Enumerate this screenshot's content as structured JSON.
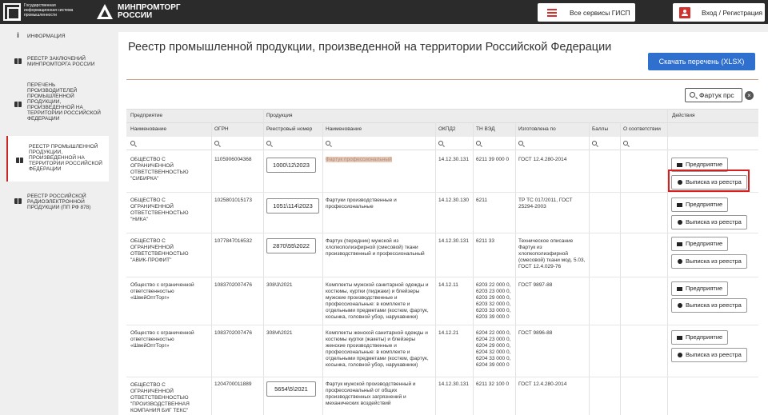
{
  "header": {
    "gisp_text": [
      "Государственная",
      "информационная система",
      "промышленности"
    ],
    "ministry": [
      "МИНПРОМТОРГ",
      "РОССИИ"
    ],
    "services_label": "Все сервисы ГИСП",
    "login_label": "Вход / Регистрация"
  },
  "sidebar": {
    "items": [
      {
        "label": "Информация",
        "icon": "info-icon"
      },
      {
        "label": "Реестр заключений Минпромторга России",
        "icon": "book-icon"
      },
      {
        "label": "Перечень производителей промышленной продукции, произведенной на территории Российской Федерации",
        "icon": "book-icon"
      },
      {
        "label": "Реестр промышленной продукции, произведенной на территории Российской Федерации",
        "icon": "book-icon",
        "active": true
      },
      {
        "label": "Реестр российской радиоэлектронной продукции (ПП РФ 878)",
        "icon": "book-icon"
      }
    ]
  },
  "main": {
    "title": "Реестр промышленной продукции, произведенной на территории Российской Федерации",
    "download_label": "Скачать перечень (XLSX)",
    "search_value": "Фартук прс",
    "clear_label": "×"
  },
  "table": {
    "group_headers": {
      "enterprise": "Предприятие",
      "product": "Продукция",
      "actions": "Действия"
    },
    "columns": [
      "Наименование",
      "ОГРН",
      "Реестровый номер",
      "Наименование",
      "ОКПД2",
      "ТН ВЭД",
      "Изготовлена по",
      "Баллы",
      "О соответствии"
    ],
    "actions": {
      "enterprise_label": "Предприятие",
      "extract_label": "Выписка из реестра"
    },
    "rows": [
      {
        "name": "ОБЩЕСТВО С ОГРАНИЧЕННОЙ ОТВЕТСТВЕННОСТЬЮ \"СИБИРКА\"",
        "ogrn": "1105906004368",
        "reg": "1000\\12\\2023",
        "product": "Фартук профессиональный",
        "okpd": "14.12.30.131",
        "tnved": "6211 39 000 0",
        "made_by": "ГОСТ 12.4.280-2014"
      },
      {
        "name": "ОБЩЕСТВО С ОГРАНИЧЕННОЙ ОТВЕТСТВЕННОСТЬЮ \"НИКА\"",
        "ogrn": "1025801015173",
        "reg": "1051\\114\\2023",
        "product": "Фартуки производственные и профессиональные",
        "okpd": "14.12.30.130",
        "tnved": "6211",
        "made_by": "ТР ТС 017/2011, ГОСТ 25294-2003"
      },
      {
        "name": "ОБЩЕСТВО С ОГРАНИЧЕННОЙ ОТВЕТСТВЕННОСТЬЮ \"АВИК-ПРОФИТ\"",
        "ogrn": "1077847016532",
        "reg": "2870\\55\\2022",
        "product": "Фартук (передник) мужской из хлопкополиэфирной (смесовой) ткани производственный и профессиональный",
        "okpd": "14.12.30.131",
        "tnved": "6211 33",
        "made_by": "Техническое описание Фартук из хлопкополиэфирной (смесовой) ткани мод. 5.03, ГОСТ 12.4.029-76"
      },
      {
        "name": "Общество с ограниченной ответственностью «ШвейОптТорг»",
        "ogrn": "1083702007476",
        "reg": "308\\3\\2021",
        "product": "Комплекты мужской санитарной одежды и костюмы, куртки (пиджаки) и блейзеры мужские производственные и профессиональные: в комплекте и отдельными предметами (костюм, фартук, косынка, головной убор, нарукавники)",
        "okpd": "14.12.11",
        "tnved": "6203 22 000 0, 6203 23 000 0, 6203 29 000 0, 6203 32 000 0, 6203 33 000 0, 6203 39 000 0",
        "made_by": "ГОСТ 9897-88"
      },
      {
        "name": "Общество с ограниченной ответственностью «ШвейОптТорг»",
        "ogrn": "1083702007476",
        "reg": "308\\4\\2021",
        "product": "Комплекты женской санитарной одежды и костюмы куртки (жакеты) и блейзеры женские производственные и профессиональные: в комплекте и отдельными предметами (костюм, фартук, косынка, головной убор, нарукавники)",
        "okpd": "14.12.21",
        "tnved": "6204 22 000 0, 6204 23 000 0, 6204 29 000 0, 6204 32 000 0, 6204 33 000 0, 6204 39 000 0",
        "made_by": "ГОСТ 9896-88"
      },
      {
        "name": "ОБЩЕСТВО С ОГРАНИЧЕННОЙ ОТВЕТСТВЕННОСТЬЮ \"ПРОИЗВОДСТВЕННАЯ КОМПАНИЯ БИГ ТЕКС\"",
        "ogrn": "1204700011889",
        "reg": "5654\\5\\2021",
        "product": "Фартук мужской производственный и профессиональный от общих производственных загрязнений и механических воздействий",
        "okpd": "14.12.30.131",
        "tnved": "6211 32 100 0",
        "made_by": "ГОСТ 12.4.280-2014"
      }
    ]
  }
}
